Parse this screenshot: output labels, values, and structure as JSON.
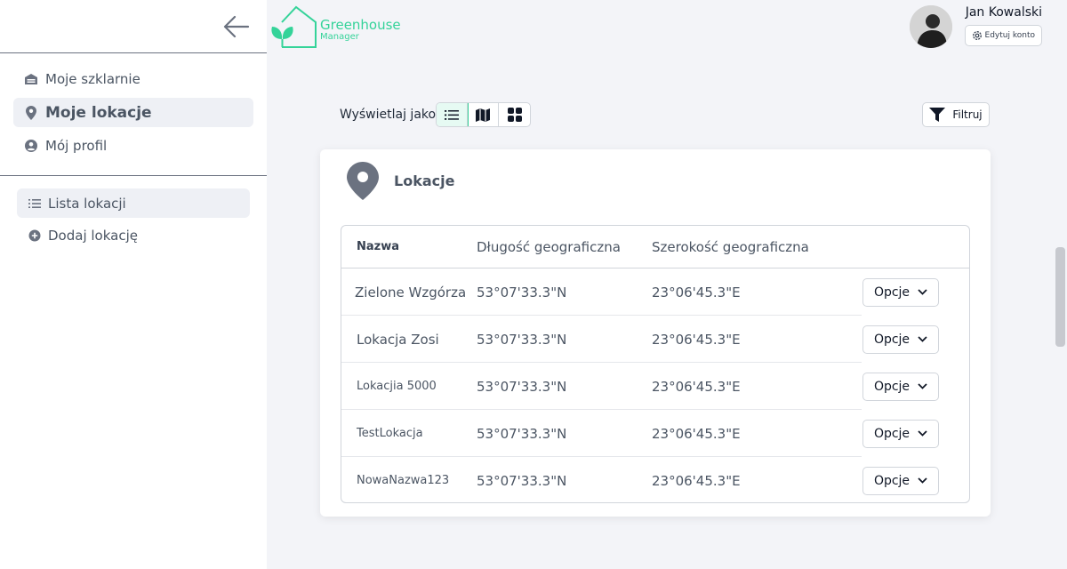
{
  "app": {
    "logo_title": "Greenhouse",
    "logo_subtitle": "Manager",
    "brand_color": "#34d399"
  },
  "user": {
    "name": "Jan Kowalski",
    "edit_label": "Edytuj konto"
  },
  "sidebar": {
    "main": [
      {
        "label": "Moje szklarnie",
        "icon": "warehouse-icon"
      },
      {
        "label": "Moje lokacje",
        "icon": "map-pin-icon",
        "active": true
      },
      {
        "label": "Mój profil",
        "icon": "user-circle-icon"
      }
    ],
    "sub": [
      {
        "label": "Lista lokacji",
        "icon": "list-icon",
        "active": true
      },
      {
        "label": "Dodaj lokację",
        "icon": "plus-circle-icon"
      }
    ]
  },
  "toolbar": {
    "display_as_label": "Wyświetlaj jako",
    "views": [
      "list-icon",
      "map-icon",
      "grid-icon"
    ],
    "active_view": "list",
    "filter_label": "Filtruj"
  },
  "card": {
    "title": "Lokacje",
    "columns": [
      "Nazwa",
      "Długość geograficzna",
      "Szerokość geograficzna"
    ],
    "rows": [
      {
        "name": "Zielone Wzgórza",
        "lng": "53°07'33.3\"N",
        "lat": "23°06'45.3\"E",
        "options": "Opcje"
      },
      {
        "name": "Lokacja Zosi",
        "lng": "53°07'33.3\"N",
        "lat": "23°06'45.3\"E",
        "options": "Opcje"
      },
      {
        "name": "Lokacjia 5000",
        "lng": "53°07'33.3\"N",
        "lat": "23°06'45.3\"E",
        "options": "Opcje"
      },
      {
        "name": "TestLokacja",
        "lng": "53°07'33.3\"N",
        "lat": "23°06'45.3\"E",
        "options": "Opcje"
      },
      {
        "name": "NowaNazwa123",
        "lng": "53°07'33.3\"N",
        "lat": "23°06'45.3\"E",
        "options": "Opcje"
      }
    ]
  }
}
